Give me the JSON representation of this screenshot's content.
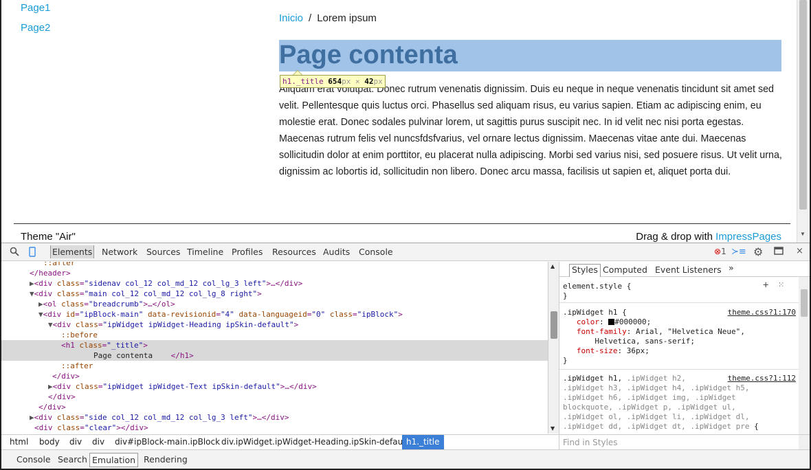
{
  "page": {
    "sidebar_links": [
      "Page1",
      "Page2"
    ],
    "breadcrumb": {
      "home": "Inicio",
      "separator": "/",
      "current": "Lorem ipsum"
    },
    "title": "Page contenta",
    "tooltip": {
      "tag": "h1._title",
      "width": "654",
      "height": "42",
      "unit": "px",
      "times": "×"
    },
    "body_text": "Aliquam erat volutpat. Donec rutrum venenatis dignissim. Duis eu neque in neque venenatis tincidunt sit amet sed velit. Pellentesque quis luctus orci. Phasellus sed aliquam risus, eu varius sapien. Etiam ac adipiscing enim, eu molestie erat. Donec sodales pulvinar lorem, ut sagittis purus suscipit nec. In id velit nec nisi porta egestas. Maecenas rutrum felis vel nuncsfdsfvarius, vel ornare lectus dignissim. Maecenas vitae ante dui. Maecenas sollicitudin dolor at enim porttitor, eu placerat nulla adipiscing. Morbi sed varius nisi, sed posuere risus. Ut velit urna, dignissim ac lobortis id, sollicitudin non libero. Donec arcu massa, facilisis ut sapien et, aliquet porta dui.",
    "footer": {
      "theme": "Theme \"Air\"",
      "drag_prefix": "Drag & drop with ",
      "drag_link": "ImpressPages"
    }
  },
  "devtools": {
    "tabs": [
      "Elements",
      "Network",
      "Sources",
      "Timeline",
      "Profiles",
      "Resources",
      "Audits",
      "Console"
    ],
    "error_count": "1",
    "dom": [
      {
        "indent": 10,
        "html": "<span class='pseudo'>::after</span>"
      },
      {
        "indent": 4,
        "html": "&lt;/header&gt;"
      },
      {
        "indent": 4,
        "html": "<span class='tri'>▶</span>&lt;div <span class='attr'>class</span>=<span class='val'>\"sidenav col_12 col_md_12 col_lg_3 left\"</span>&gt;…&lt;/div&gt;"
      },
      {
        "indent": 4,
        "html": "<span class='tri'>▼</span>&lt;div <span class='attr'>class</span>=<span class='val'>\"main col_12 col_md_12 col_lg_8 right\"</span>&gt;"
      },
      {
        "indent": 8,
        "html": "<span class='tri'>▶</span>&lt;ol <span class='attr'>class</span>=<span class='val'>\"breadcrumb\"</span>&gt;…&lt;/ol&gt;"
      },
      {
        "indent": 8,
        "html": "<span class='tri'>▼</span>&lt;div <span class='attr'>id</span>=<span class='val'>\"ipBlock-main\"</span> <span class='attr'>data-revisionid</span>=<span class='val'>\"4\"</span> <span class='attr'>data-languageid</span>=<span class='val'>\"0\"</span> <span class='attr'>class</span>=<span class='val'>\"ipBlock\"</span>&gt;"
      },
      {
        "indent": 12,
        "html": "<span class='tri'>▼</span>&lt;div <span class='attr'>class</span>=<span class='val'>\"ipWidget ipWidget-Heading ipSkin-default\"</span>&gt;"
      },
      {
        "indent": 18,
        "html": "<span class='pseudo'>::before</span>"
      },
      {
        "indent": 18,
        "html": "&lt;h1 <span class='attr'>class</span>=<span class='val'>\"_title\"</span>&gt;",
        "sel": true
      },
      {
        "indent": 32,
        "html": "<span class='txt'>Page contenta</span>    &lt;/h1&gt;",
        "sel": true
      },
      {
        "indent": 18,
        "html": "<span class='pseudo'>::after</span>"
      },
      {
        "indent": 14,
        "html": "&lt;/div&gt;"
      },
      {
        "indent": 12,
        "html": "<span class='tri'>▶</span>&lt;div <span class='attr'>class</span>=<span class='val'>\"ipWidget ipWidget-Text ipSkin-default\"</span>&gt;…&lt;/div&gt;"
      },
      {
        "indent": 12,
        "html": "&lt;/div&gt;"
      },
      {
        "indent": 8,
        "html": "&lt;/div&gt;"
      },
      {
        "indent": 4,
        "html": "<span class='tri'>▶</span>&lt;div <span class='attr'>class</span>=<span class='val'>\"side col_12 col_md_12 col_lg_3 left\"</span>&gt;…&lt;/div&gt;"
      },
      {
        "indent": 6,
        "html": "&lt;div <span class='attr'>class</span>=<span class='val'>\"clear\"</span>&gt;&lt;/div&gt;"
      }
    ],
    "breadcrumbs": [
      "html",
      "body",
      "div",
      "div",
      "div#ipBlock-main.ipBlock",
      "div.ipWidget.ipWidget-Heading.ipSkin-default",
      "h1._title"
    ],
    "styles_tabs": {
      "styles": "Styles",
      "computed": "Computed",
      "events": "Event Listeners",
      "more": "»"
    },
    "find_styles": "Find in Styles",
    "drawer_tabs": [
      "Console",
      "Search",
      "Emulation",
      "Rendering"
    ]
  }
}
